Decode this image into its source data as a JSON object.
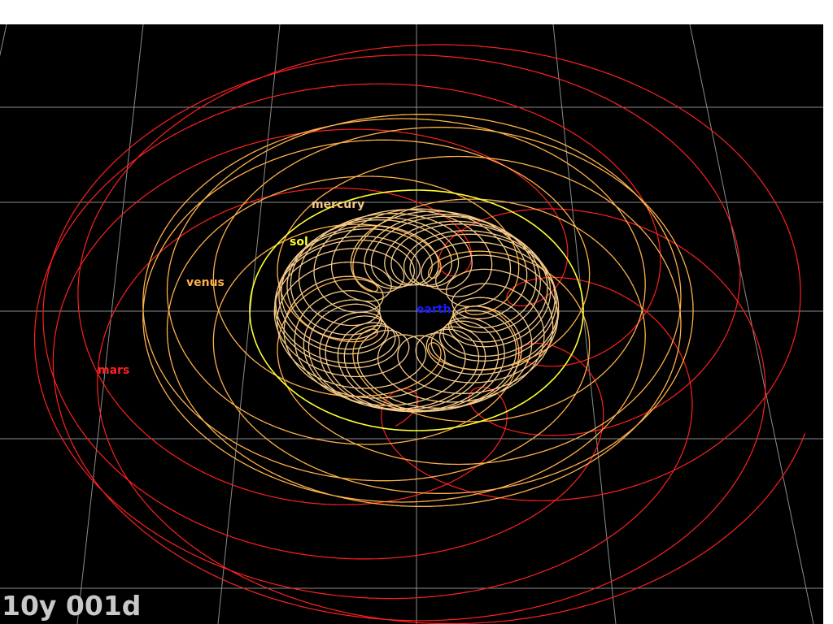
{
  "title_bar": "",
  "scene": {
    "background": "#000000",
    "grid_color": "#8c8c8c",
    "bodies": [
      {
        "name": "mercury",
        "color": "#f5c987"
      },
      {
        "name": "sol",
        "color": "#ffff33"
      },
      {
        "name": "venus",
        "color": "#ffb04a"
      },
      {
        "name": "earth",
        "color": "#1a1aff"
      },
      {
        "name": "mars",
        "color": "#ff2020"
      }
    ]
  },
  "time": {
    "readout": "10y 001d"
  }
}
